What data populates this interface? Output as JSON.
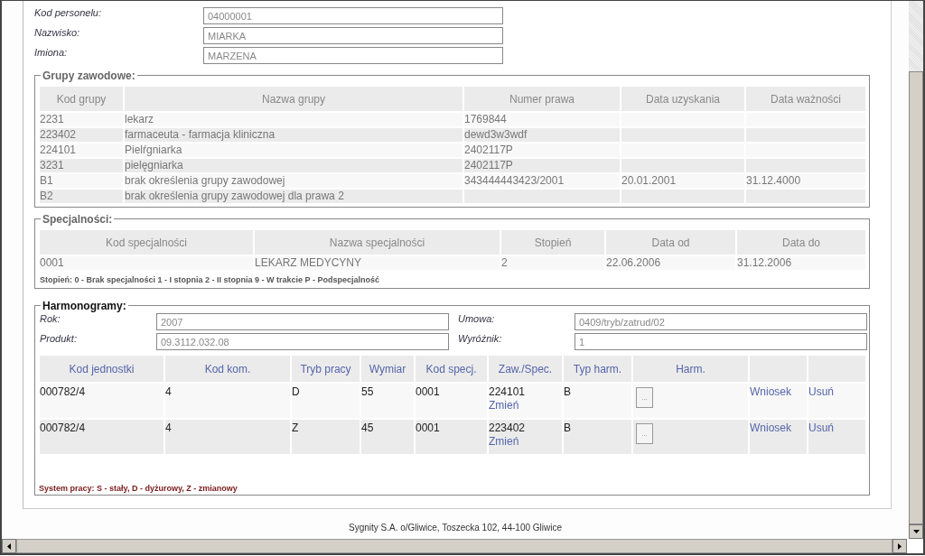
{
  "personnel": {
    "fields": [
      {
        "label": "Kod personelu:",
        "value": "04000001"
      },
      {
        "label": "Nazwisko:",
        "value": "MIARKA"
      },
      {
        "label": "Imiona:",
        "value": "MARZENA"
      }
    ]
  },
  "groups": {
    "title": "Grupy zawodowe:",
    "columns": [
      "Kod grupy",
      "Nazwa grupy",
      "Numer prawa",
      "Data uzyskania",
      "Data ważności"
    ],
    "rows": [
      {
        "code": "2231",
        "name": "lekarz",
        "number": "1769844"
      },
      {
        "code": "223402",
        "name": "farmaceuta - farmacja kliniczna",
        "number": "dewd3w3wdf"
      },
      {
        "code": "224101",
        "name": "Pielŕgniarka",
        "number": "2402117P"
      },
      {
        "code": "3231",
        "name": "pielęgniarka",
        "number": "2402117P"
      },
      {
        "code": "B1",
        "name": "brak określenia grupy zawodowej",
        "number": "343444443423/2001",
        "obtained": "20.01.2001",
        "expires": "31.12.4000"
      },
      {
        "code": "B2",
        "name": "brak określenia grupy zawodowej dla prawa 2"
      }
    ]
  },
  "specialties": {
    "title": "Specjalności:",
    "columns": [
      "Kod specjalności",
      "Nazwa specjalności",
      "Stopień",
      "Data od",
      "Data do"
    ],
    "rows": [
      {
        "code": "0001",
        "name": "LEKARZ MEDYCYNY",
        "degree": "2",
        "from": "22.06.2006",
        "to": "31.12.2006"
      }
    ],
    "legend": "Stopień: 0 - Brak specjalności 1 - I stopnia 2 - II stopnia 9 - W trakcie P - Podspecjalność"
  },
  "schedules": {
    "title": "Harmonogramy:",
    "fields": [
      {
        "label": "Rok:",
        "value": "2007"
      },
      {
        "label": "Umowa:",
        "value": "0409/tryb/zatrud/02"
      },
      {
        "label": "Produkt:",
        "value": "09.3112.032.08"
      },
      {
        "label": "Wyróżnik:",
        "value": "1"
      }
    ],
    "columns": [
      "Kod jednostki",
      "Kod kom.",
      "Tryb pracy",
      "Wymiar",
      "Kod specj.",
      "Zaw./Spec.",
      "Typ harm.",
      "Harm."
    ],
    "rows": [
      {
        "unit": "000782/4",
        "kom": "4",
        "mode": "D",
        "dim": "55",
        "spec": "0001",
        "zaw": "224101",
        "change": "Zmień",
        "type": "B",
        "harm": "...",
        "request": "Wniosek",
        "delete": "Usuń"
      },
      {
        "unit": "000782/4",
        "kom": "4",
        "mode": "Z",
        "dim": "45",
        "spec": "0001",
        "zaw": "223402",
        "change": "Zmień",
        "type": "B",
        "harm": "...",
        "request": "Wniosek",
        "delete": "Usuń"
      }
    ],
    "legend": "System pracy: S - stały, D - dyżurowy, Z - zmianowy"
  },
  "footer": "Sygnity S.A. o/Gliwice, Toszecka 102, 44-100 Gliwice"
}
